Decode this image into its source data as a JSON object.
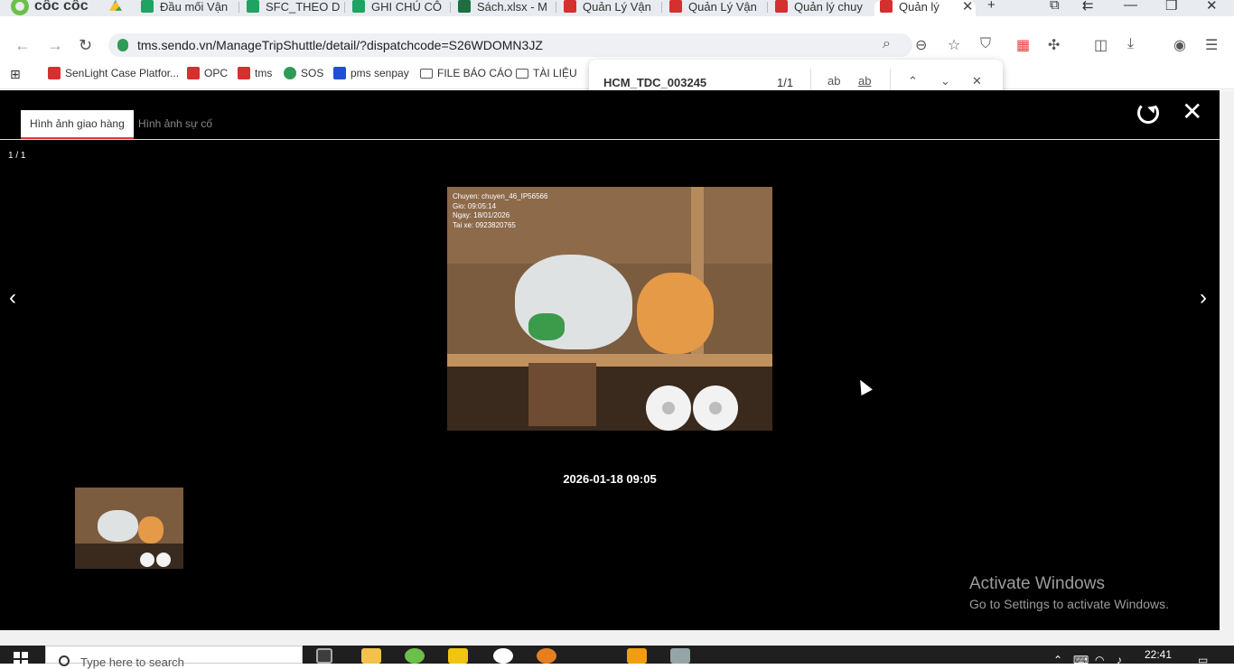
{
  "browser": {
    "brand": "cốc cốc",
    "tabs": [
      {
        "title": "Đầu mối Vận",
        "icon": "sheets"
      },
      {
        "title": "SFC_THEO D",
        "icon": "sheets"
      },
      {
        "title": "GHI CHÚ CÔ",
        "icon": "sheets"
      },
      {
        "title": "Sách.xlsx - M",
        "icon": "excel"
      },
      {
        "title": "Quản Lý Vận",
        "icon": "sendo"
      },
      {
        "title": "Quản Lý Vận",
        "icon": "sendo"
      },
      {
        "title": "Quản lý chuy",
        "icon": "sendo"
      },
      {
        "title": "Quản lý",
        "icon": "sendo",
        "active": true
      }
    ],
    "new_tab": "+",
    "url": "tms.sendo.vn/ManageTripShuttle/detail/?dispatchcode=S26WDOMN3JZ",
    "bookmarks": [
      {
        "label": "SenLight Case Platfor...",
        "icon": "sendo"
      },
      {
        "label": "OPC",
        "icon": "sendo"
      },
      {
        "label": "tms",
        "icon": "sendo"
      },
      {
        "label": "SOS",
        "icon": "sos"
      },
      {
        "label": "pms senpay",
        "icon": "pms"
      },
      {
        "label": "FILE BÁO CÁO",
        "icon": "folder"
      },
      {
        "label": "TÀI LIỆU",
        "icon": "folder"
      }
    ]
  },
  "find": {
    "query": "HCM_TDC_003245",
    "count": "1/1",
    "match_case": "ab",
    "whole_word": "ab"
  },
  "viewer": {
    "tabs": [
      "Hình ảnh giao hàng",
      "Hình ảnh sự cố"
    ],
    "counter": "1 / 1",
    "prev": "‹",
    "next": "›",
    "close": "✕",
    "photo_stamp": [
      "Chuyen: chuyen_46_IP56566",
      "Gio: 09:05:14",
      "Ngay: 18/01/2026",
      "Tai xe: 0923820765"
    ],
    "timestamp": "2026-01-18 09:05"
  },
  "watermark": {
    "title": "Activate Windows",
    "subtitle": "Go to Settings to activate Windows."
  },
  "taskbar": {
    "search_placeholder": "Type here to search",
    "clock": "22:41"
  }
}
